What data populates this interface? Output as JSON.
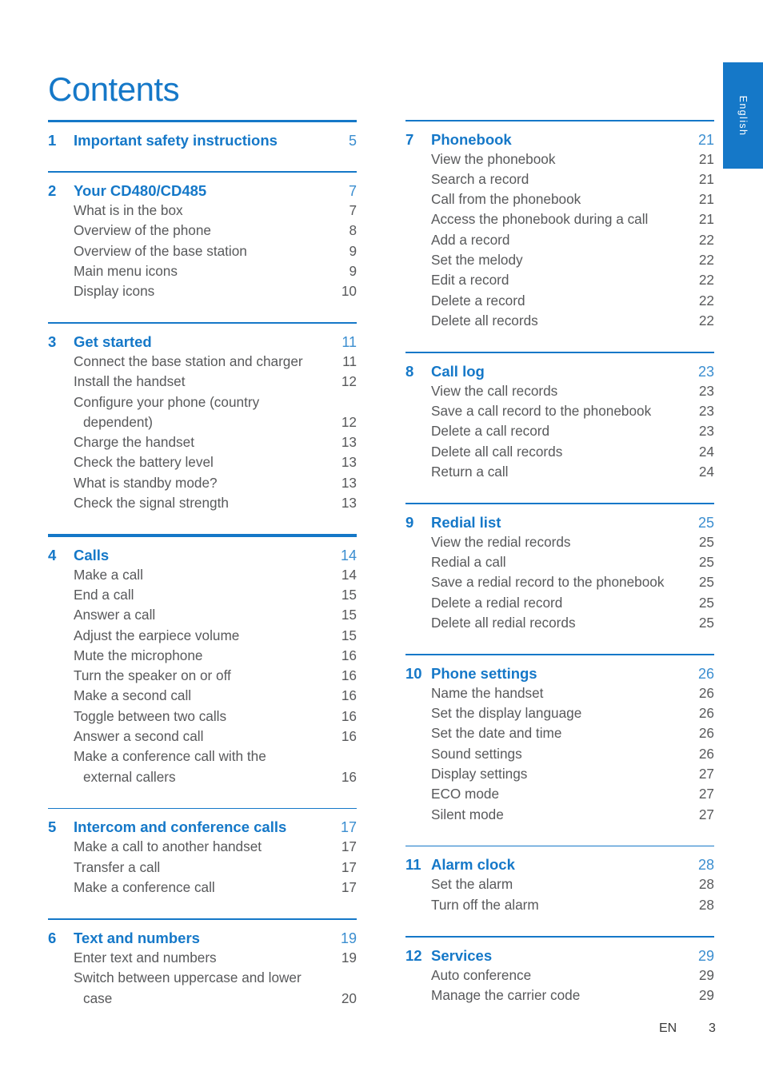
{
  "page_title": "Contents",
  "side_tab": {
    "label": "English"
  },
  "footer": {
    "locale": "EN",
    "page_number": "3"
  },
  "colors": {
    "brand_blue": "#1578c8",
    "entry_gray": "#58595b",
    "page_number_blue": "#3b8ed0"
  },
  "columns": {
    "left": [
      {
        "number": "1",
        "title": "Important safety instructions",
        "page": "5",
        "rule": "thick",
        "entries": []
      },
      {
        "number": "2",
        "title": "Your CD480/CD485",
        "page": "7",
        "rule": "thin",
        "entries": [
          {
            "text": "What is in the box",
            "page": "7"
          },
          {
            "text": "Overview of the phone",
            "page": "8"
          },
          {
            "text": "Overview of the base station",
            "page": "9"
          },
          {
            "text": "Main menu icons",
            "page": "9"
          },
          {
            "text": "Display icons",
            "page": "10"
          }
        ]
      },
      {
        "number": "3",
        "title": "Get started",
        "page": "11",
        "rule": "thin",
        "entries": [
          {
            "text": "Connect the base station and charger",
            "page": "11"
          },
          {
            "text": "Install the handset",
            "page": "12"
          },
          {
            "text": "Configure your phone (country",
            "page": ""
          },
          {
            "text": "dependent)",
            "page": "12",
            "wrap": true
          },
          {
            "text": "Charge the handset",
            "page": "13"
          },
          {
            "text": "Check the battery level",
            "page": "13"
          },
          {
            "text": "What is standby mode?",
            "page": "13"
          },
          {
            "text": "Check the signal strength",
            "page": "13"
          }
        ]
      },
      {
        "number": "4",
        "title": "Calls",
        "page": "14",
        "rule": "thick",
        "entries": [
          {
            "text": "Make a call",
            "page": "14"
          },
          {
            "text": "End a call",
            "page": "15"
          },
          {
            "text": "Answer a call",
            "page": "15"
          },
          {
            "text": "Adjust the earpiece volume",
            "page": "15"
          },
          {
            "text": "Mute the microphone",
            "page": "16"
          },
          {
            "text": "Turn the speaker on or off",
            "page": "16"
          },
          {
            "text": "Make a second call",
            "page": "16"
          },
          {
            "text": "Toggle between two calls",
            "page": "16"
          },
          {
            "text": "Answer a second call",
            "page": "16"
          },
          {
            "text": "Make a conference call with the",
            "page": ""
          },
          {
            "text": "external callers",
            "page": "16",
            "wrap": true
          }
        ]
      },
      {
        "number": "5",
        "title": "Intercom and conference calls",
        "page": "17",
        "rule": "thin",
        "entries": [
          {
            "text": "Make a call to another handset",
            "page": "17"
          },
          {
            "text": "Transfer a call",
            "page": "17"
          },
          {
            "text": "Make a conference call",
            "page": "17"
          }
        ]
      },
      {
        "number": "6",
        "title": "Text and numbers",
        "page": "19",
        "rule": "thin",
        "entries": [
          {
            "text": "Enter text and numbers",
            "page": "19"
          },
          {
            "text": "Switch between uppercase and lower",
            "page": ""
          },
          {
            "text": "case",
            "page": "20",
            "wrap": true
          }
        ]
      }
    ],
    "right": [
      {
        "number": "7",
        "title": "Phonebook",
        "page": "21",
        "rule": "thin",
        "entries": [
          {
            "text": "View the phonebook",
            "page": "21"
          },
          {
            "text": "Search a record",
            "page": "21"
          },
          {
            "text": "Call from the phonebook",
            "page": "21"
          },
          {
            "text": "Access the phonebook during a call",
            "page": "21"
          },
          {
            "text": "Add a record",
            "page": "22"
          },
          {
            "text": "Set the melody",
            "page": "22"
          },
          {
            "text": "Edit a record",
            "page": "22"
          },
          {
            "text": "Delete a record",
            "page": "22"
          },
          {
            "text": "Delete all records",
            "page": "22"
          }
        ]
      },
      {
        "number": "8",
        "title": "Call log",
        "page": "23",
        "rule": "thin",
        "entries": [
          {
            "text": "View the call records",
            "page": "23"
          },
          {
            "text": "Save a call record to the phonebook",
            "page": "23"
          },
          {
            "text": "Delete a call record",
            "page": "23"
          },
          {
            "text": "Delete all call records",
            "page": "24"
          },
          {
            "text": "Return a call",
            "page": "24"
          }
        ]
      },
      {
        "number": "9",
        "title": "Redial list",
        "page": "25",
        "rule": "thin",
        "entries": [
          {
            "text": "View the redial records",
            "page": "25"
          },
          {
            "text": "Redial a call",
            "page": "25"
          },
          {
            "text": "Save a redial record to the phonebook",
            "page": "25"
          },
          {
            "text": "Delete a redial record",
            "page": "25"
          },
          {
            "text": "Delete all redial records",
            "page": "25"
          }
        ]
      },
      {
        "number": "10",
        "title": "Phone settings",
        "page": "26",
        "rule": "thin",
        "entries": [
          {
            "text": "Name the handset",
            "page": "26"
          },
          {
            "text": "Set the display language",
            "page": "26"
          },
          {
            "text": "Set the date and time",
            "page": "26"
          },
          {
            "text": "Sound settings",
            "page": "26"
          },
          {
            "text": "Display settings",
            "page": "27"
          },
          {
            "text": "ECO mode",
            "page": "27"
          },
          {
            "text": "Silent mode",
            "page": "27"
          }
        ]
      },
      {
        "number": "11",
        "title": "Alarm clock",
        "page": "28",
        "rule": "thin",
        "entries": [
          {
            "text": "Set the alarm",
            "page": "28"
          },
          {
            "text": "Turn off the alarm",
            "page": "28"
          }
        ]
      },
      {
        "number": "12",
        "title": "Services",
        "page": "29",
        "rule": "thin",
        "entries": [
          {
            "text": "Auto conference",
            "page": "29"
          },
          {
            "text": "Manage the carrier code",
            "page": "29"
          }
        ]
      }
    ]
  }
}
